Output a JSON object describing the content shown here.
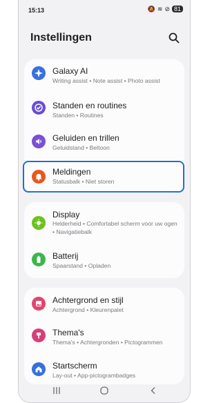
{
  "status": {
    "time": "15:13",
    "battery": "81"
  },
  "header": {
    "title": "Instellingen"
  },
  "groups": [
    {
      "items": [
        {
          "label": "Galaxy AI",
          "sub": "Writing assist • Note assist • Photo assist",
          "color": "#3a6fe0",
          "icon": "galaxy-ai-icon"
        },
        {
          "label": "Standen en routines",
          "sub": "Standen • Routines",
          "color": "#6a4bd6",
          "icon": "modes-routines-icon"
        },
        {
          "label": "Geluiden en trillen",
          "sub": "Geluidstand • Beltoon",
          "color": "#7b4fd8",
          "icon": "sound-icon"
        },
        {
          "label": "Meldingen",
          "sub": "Statusbalk • Niet storen",
          "color": "#e8581c",
          "icon": "notification-bell-icon"
        }
      ]
    },
    {
      "items": [
        {
          "label": "Display",
          "sub": "Helderheid • Comfortabel scherm voor uw ogen • Navigatiebalk",
          "color": "#6cc21c",
          "icon": "display-sun-icon"
        },
        {
          "label": "Batterij",
          "sub": "Spaarstand • Opladen",
          "color": "#3cb64a",
          "icon": "battery-icon"
        }
      ]
    },
    {
      "items": [
        {
          "label": "Achtergrond en stijl",
          "sub": "Achtergrond • Kleurenpalet",
          "color": "#e0456e",
          "icon": "wallpaper-icon"
        },
        {
          "label": "Thema's",
          "sub": "Thema's • Achtergronden • Pictogrammen",
          "color": "#d83f7a",
          "icon": "themes-icon"
        },
        {
          "label": "Startscherm",
          "sub": "Lay-out • App-pictogrambadges",
          "color": "#3470e0",
          "icon": "home-icon"
        }
      ]
    }
  ]
}
